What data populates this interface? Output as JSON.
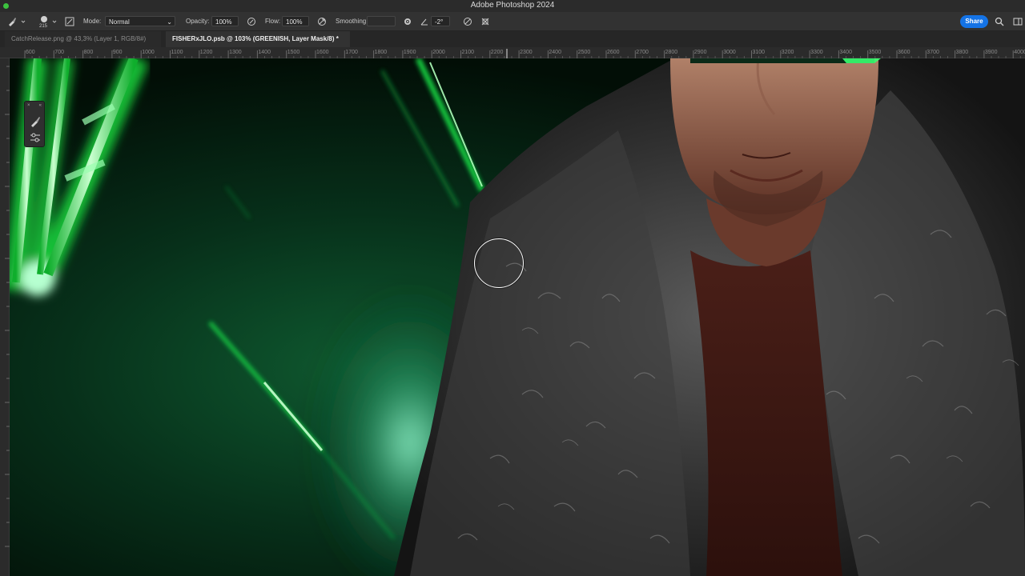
{
  "window": {
    "title": "Adobe Photoshop 2024"
  },
  "options_bar": {
    "brush_size": "215",
    "mode_label": "Mode:",
    "mode_value": "Normal",
    "opacity_label": "Opacity:",
    "opacity_value": "100%",
    "flow_label": "Flow:",
    "flow_value": "100%",
    "smoothing_label": "Smoothing:",
    "angle_value": "-2°",
    "share_label": "Share"
  },
  "tabs": [
    {
      "label": "CatchRelease.png @ 43,3% (Layer 1, RGB/8#)"
    },
    {
      "label": "FISHERxJLO.psb @ 103% (GREENISH, Layer Mask/8) *"
    }
  ],
  "ruler": {
    "labels": [
      "600",
      "700",
      "800",
      "900",
      "1000",
      "1100",
      "1200",
      "1300",
      "1400",
      "1500",
      "1600",
      "1700",
      "1800",
      "1900",
      "2000",
      "2100",
      "2200",
      "2300",
      "2400",
      "2500",
      "2600",
      "2700",
      "2800",
      "2900",
      "3000",
      "3100",
      "3200",
      "3300",
      "3400",
      "3500",
      "3600",
      "3700",
      "3800",
      "3900",
      "4000"
    ]
  },
  "colors": {
    "accent": "#1473e6",
    "traffic_green": "#3cc23f",
    "neon": "#2cff5a"
  }
}
